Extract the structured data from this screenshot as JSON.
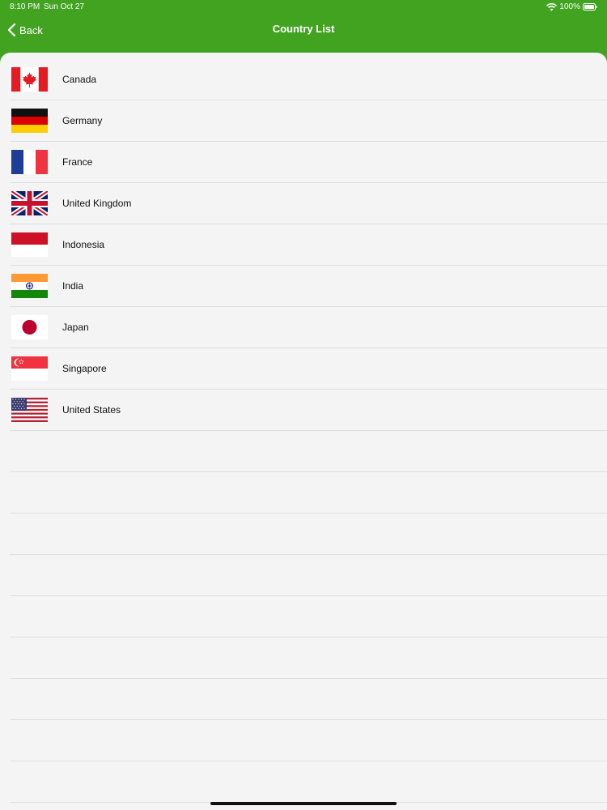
{
  "status_bar": {
    "time": "8:10 PM",
    "date": "Sun Oct 27",
    "battery_percent": "100%",
    "icons": [
      "wifi-icon",
      "battery-icon"
    ]
  },
  "nav": {
    "back_label": "Back",
    "back_icon": "chevron-left-icon",
    "title": "Country List"
  },
  "colors": {
    "header_background": "#42a321",
    "list_background": "#f4f4f4",
    "separator": "#dedede"
  },
  "countries": [
    {
      "name": "Canada",
      "flag_icon": "canada-flag-icon"
    },
    {
      "name": "Germany",
      "flag_icon": "germany-flag-icon"
    },
    {
      "name": "France",
      "flag_icon": "france-flag-icon"
    },
    {
      "name": "United Kingdom",
      "flag_icon": "united-kingdom-flag-icon"
    },
    {
      "name": "Indonesia",
      "flag_icon": "indonesia-flag-icon"
    },
    {
      "name": "India",
      "flag_icon": "india-flag-icon"
    },
    {
      "name": "Japan",
      "flag_icon": "japan-flag-icon"
    },
    {
      "name": "Singapore",
      "flag_icon": "singapore-flag-icon"
    },
    {
      "name": "United States",
      "flag_icon": "united-states-flag-icon"
    }
  ]
}
